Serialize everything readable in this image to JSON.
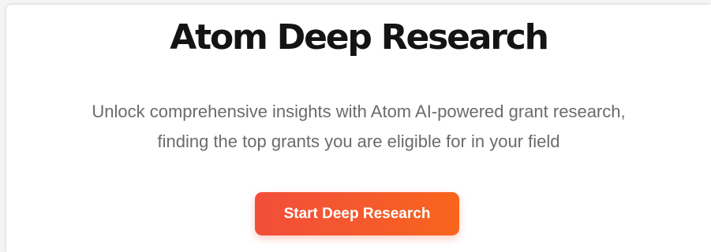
{
  "hero": {
    "title": "Atom Deep Research",
    "subtitle_line1": "Unlock comprehensive insights with Atom AI-powered grant research,",
    "subtitle_line2": "finding the top grants you are eligible for in your field",
    "cta_label": "Start Deep Research"
  },
  "colors": {
    "title": "#141414",
    "subtitle": "#6b6b6b",
    "cta_gradient_start": "#f24e3a",
    "cta_gradient_end": "#f8651b",
    "cta_text": "#ffffff",
    "background": "#ffffff"
  }
}
